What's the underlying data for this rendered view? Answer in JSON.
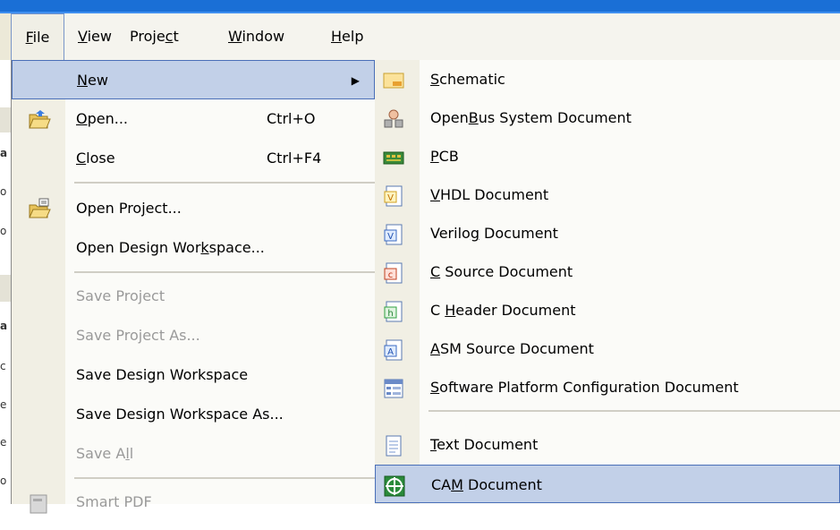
{
  "menubar": {
    "items": [
      {
        "pre": "",
        "u": "F",
        "post": "ile"
      },
      {
        "pre": "",
        "u": "V",
        "post": "iew"
      },
      {
        "pre": "Proje",
        "u": "c",
        "post": "t"
      },
      {
        "pre": "",
        "u": "W",
        "post": "indow"
      },
      {
        "pre": "",
        "u": "H",
        "post": "elp"
      }
    ]
  },
  "file_menu": {
    "items": [
      {
        "pre": "",
        "u": "N",
        "post": "ew",
        "shortcut": "",
        "icon": "none",
        "disabled": false
      },
      {
        "pre": "",
        "u": "O",
        "post": "pen...",
        "shortcut": "Ctrl+O",
        "icon": "open-folder-icon",
        "disabled": false
      },
      {
        "pre": "",
        "u": "C",
        "post": "lose",
        "shortcut": "Ctrl+F4",
        "icon": "none",
        "disabled": false
      },
      {
        "pre": "Open Pro",
        "u": "j",
        "post": "ect...",
        "shortcut": "",
        "icon": "open-project-icon",
        "disabled": false
      },
      {
        "pre": "Open Design Wor",
        "u": "k",
        "post": "space...",
        "shortcut": "",
        "icon": "none",
        "disabled": false
      },
      {
        "pre": "Save Project",
        "u": "",
        "post": "",
        "shortcut": "",
        "icon": "none",
        "disabled": true
      },
      {
        "pre": "Save Project As...",
        "u": "",
        "post": "",
        "shortcut": "",
        "icon": "none",
        "disabled": true
      },
      {
        "pre": "Save Design Workspace",
        "u": "",
        "post": "",
        "shortcut": "",
        "icon": "none",
        "disabled": false
      },
      {
        "pre": "Save Design Workspace As...",
        "u": "",
        "post": "",
        "shortcut": "",
        "icon": "none",
        "disabled": false
      },
      {
        "pre": "Save A",
        "u": "l",
        "post": "l",
        "shortcut": "",
        "icon": "none",
        "disabled": true
      },
      {
        "pre": "Smart PDF",
        "u": "",
        "post": "",
        "shortcut": "",
        "icon": "smart-pdf-icon",
        "disabled": true
      }
    ]
  },
  "new_submenu": {
    "items": [
      {
        "pre": "",
        "u": "S",
        "post": "chematic",
        "icon": "schematic-icon"
      },
      {
        "pre": "Open",
        "u": "B",
        "post": "us System Document",
        "icon": "openbus-icon"
      },
      {
        "pre": "",
        "u": "P",
        "post": "CB",
        "icon": "pcb-icon"
      },
      {
        "pre": "",
        "u": "V",
        "post": "HDL Document",
        "icon": "vhdl-icon"
      },
      {
        "pre": "Verilo",
        "u": "g",
        "post": " Document",
        "icon": "verilog-icon"
      },
      {
        "pre": "",
        "u": "C",
        "post": " Source Document",
        "icon": "c-source-icon"
      },
      {
        "pre": "C ",
        "u": "H",
        "post": "eader Document",
        "icon": "c-header-icon"
      },
      {
        "pre": "",
        "u": "A",
        "post": "SM Source Document",
        "icon": "asm-source-icon"
      },
      {
        "pre": "",
        "u": "S",
        "post": "oftware Platform Configuration Document",
        "icon": "software-platform-icon"
      },
      {
        "pre": "",
        "u": "T",
        "post": "ext Document",
        "icon": "text-document-icon"
      },
      {
        "pre": "CA",
        "u": "M",
        "post": " Document",
        "icon": "cam-document-icon"
      }
    ]
  },
  "behind_window": {
    "chars": [
      "a",
      "o",
      "o",
      "a",
      "c",
      "e",
      "e",
      "o"
    ]
  },
  "colors": {
    "titlebar": "#1a6fd6",
    "highlight_bg": "#c2d0e8",
    "highlight_border": "#4a6fb8",
    "disabled_text": "#9a9a9a"
  }
}
